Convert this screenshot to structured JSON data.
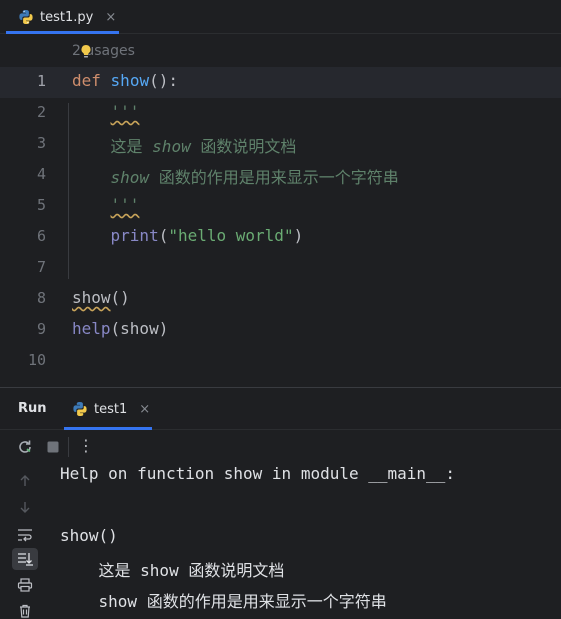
{
  "editor_tab": {
    "filename": "test1.py",
    "close": "×"
  },
  "editor": {
    "usages_hint": "2 usages",
    "line_numbers": [
      "1",
      "2",
      "3",
      "4",
      "5",
      "6",
      "7",
      "8",
      "9",
      "10"
    ],
    "code": {
      "l1_kw": "def",
      "l1_fn": "show",
      "l1_rest": "():",
      "l2_doc": "'''",
      "l3_a": "这是 ",
      "l3_b": "show",
      "l3_c": " 函数说明文档",
      "l4_a": "show",
      "l4_b": " 函数的作用是用来显示一个字符串",
      "l5_doc": "'''",
      "l6_fn": "print",
      "l6_open": "(",
      "l6_str": "\"hello world\"",
      "l6_close": ")",
      "l8_call": "show",
      "l8_rest": "()",
      "l9_fn": "help",
      "l9_rest": "(show)"
    }
  },
  "run_panel": {
    "title": "Run",
    "tab_label": "test1",
    "tab_close": "×",
    "toolbar": {
      "more": "⋮"
    },
    "console_lines": [
      "Help on function show in module __main__:",
      "",
      "show()",
      "    这是 show 函数说明文档",
      "    show 函数的作用是用来显示一个字符串"
    ]
  }
}
